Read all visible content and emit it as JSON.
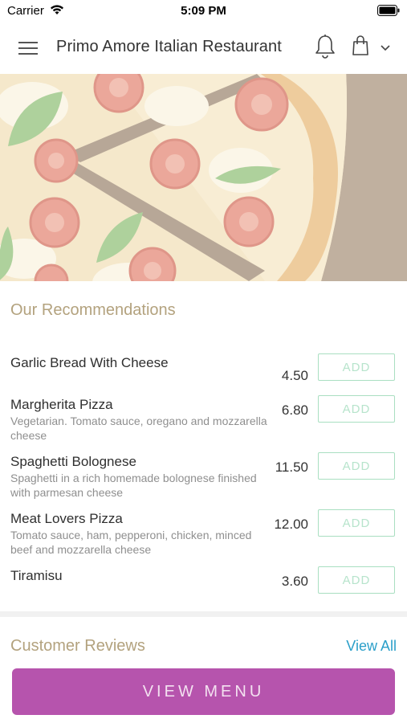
{
  "status_bar": {
    "carrier": "Carrier",
    "time": "5:09 PM"
  },
  "header": {
    "title": "Primo Amore Italian Restaurant",
    "icons": [
      "menu-icon",
      "bell-icon",
      "shopping-bag-icon",
      "chevron-down-icon"
    ]
  },
  "hero": {
    "image": "pizza-photo"
  },
  "recommendations": {
    "title": "Our Recommendations",
    "add_label": "ADD",
    "items": [
      {
        "name": "Garlic Bread With Cheese",
        "desc": "",
        "price": "4.50"
      },
      {
        "name": "Margherita Pizza",
        "desc": "Vegetarian. Tomato sauce, oregano and mozzarella cheese",
        "price": "6.80"
      },
      {
        "name": "Spaghetti Bolognese",
        "desc": "Spaghetti in a rich homemade bolognese finished with parmesan cheese",
        "price": "11.50"
      },
      {
        "name": "Meat Lovers Pizza",
        "desc": "Tomato sauce, ham, pepperoni, chicken, minced beef and mozzarella cheese",
        "price": "12.00"
      },
      {
        "name": "Tiramisu",
        "desc": "",
        "price": "3.60"
      }
    ]
  },
  "reviews": {
    "title": "Customer Reviews",
    "view_all": "View All"
  },
  "cta": {
    "label": "VIEW MENU"
  },
  "colors": {
    "accent": "#b654ad",
    "section_title": "#b3a27e",
    "link": "#2b9fc9",
    "add_border": "#a9dfc1"
  }
}
